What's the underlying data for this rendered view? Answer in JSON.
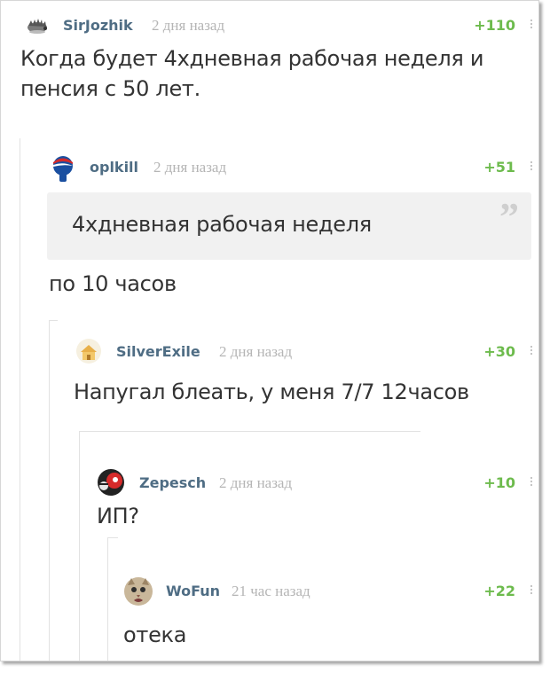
{
  "comments": [
    {
      "author": "SirJozhik",
      "time": "2 дня назад",
      "rating": "+110",
      "avatar_icon": "hedgehog-icon",
      "lines": [
        "Когда будет 4хдневная рабочая неделя и",
        "пенсия с 50 лет."
      ]
    },
    {
      "author": "oplkill",
      "time": "2 дня назад",
      "rating": "+51",
      "avatar_icon": "pepsi-ball-icon",
      "quote": "4хдневная рабочая неделя",
      "quote_mark": "”",
      "lines": [
        "по 10 часов"
      ]
    },
    {
      "author": "SilverExile",
      "time": "2 дня назад",
      "rating": "+30",
      "avatar_icon": "house-icon",
      "lines": [
        "Напугал блеать, у меня 7/7 12часов"
      ]
    },
    {
      "author": "Zepesch",
      "time": "2 дня назад",
      "rating": "+10",
      "avatar_icon": "red-face-icon",
      "lines": [
        "ИП?"
      ]
    },
    {
      "author": "WoFun",
      "time": "21 час назад",
      "rating": "+22",
      "avatar_icon": "cat-icon",
      "lines": [
        "отека"
      ]
    }
  ],
  "colors": {
    "author": "#4f6d84",
    "time": "#b5b5b5",
    "rating": "#6dbb4d",
    "text": "#333333",
    "quote_bg": "#f1f1f1",
    "thread_line": "#e2e2e2"
  }
}
